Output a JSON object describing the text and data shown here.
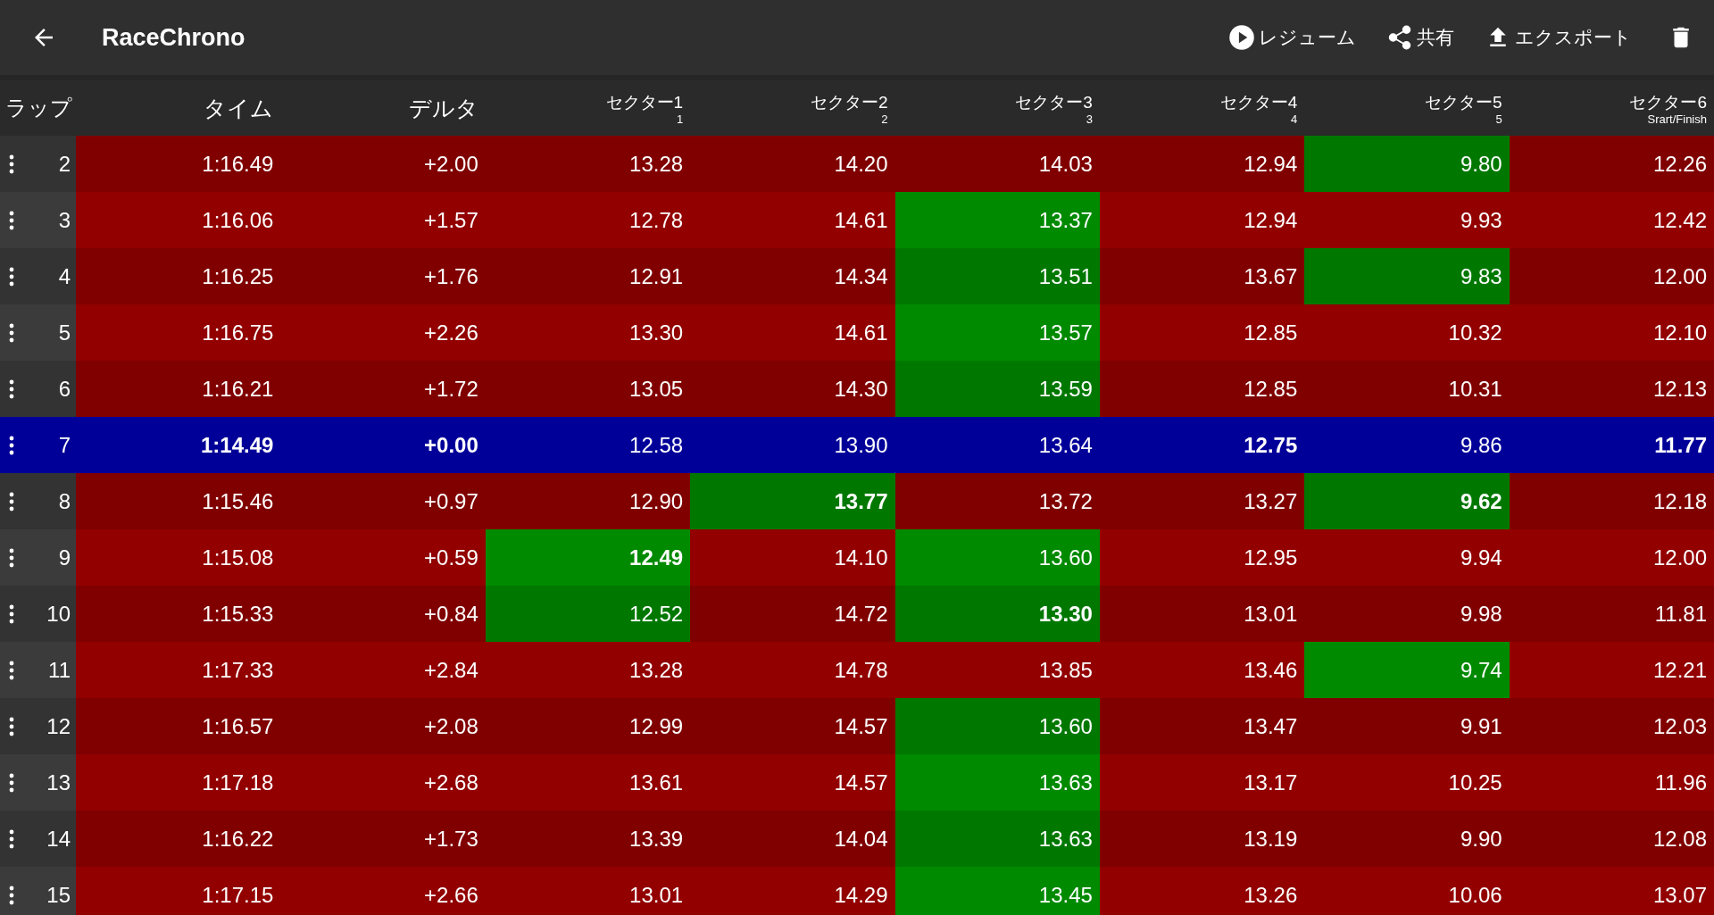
{
  "app_bar": {
    "title": "RaceChrono",
    "actions": [
      {
        "kind": "play",
        "label": "レジューム"
      },
      {
        "kind": "share",
        "label": "共有"
      },
      {
        "kind": "upload",
        "label": "エクスポート"
      },
      {
        "kind": "trash"
      }
    ]
  },
  "table": {
    "columns": [
      {
        "label": "ラップ"
      },
      {
        "label": "タイム"
      },
      {
        "label": "デルタ"
      },
      {
        "label": "セクター1",
        "sub": "1"
      },
      {
        "label": "セクター2",
        "sub": "2"
      },
      {
        "label": "セクター3",
        "sub": "3"
      },
      {
        "label": "セクター4",
        "sub": "4"
      },
      {
        "label": "セクター5",
        "sub": "5"
      },
      {
        "label": "セクター6",
        "sub": "Srart/Finish"
      }
    ],
    "rows": [
      {
        "selected": false,
        "cells": [
          {
            "kind": "lap",
            "text": "2"
          },
          {
            "kind": "value",
            "text": "1:16.49",
            "bold": false,
            "fast": false
          },
          {
            "kind": "value",
            "text": "+2.00",
            "bold": false,
            "fast": false
          },
          {
            "kind": "value",
            "text": "13.28",
            "bold": false,
            "fast": false
          },
          {
            "kind": "value",
            "text": "14.20",
            "bold": false,
            "fast": false
          },
          {
            "kind": "value",
            "text": "14.03",
            "bold": false,
            "fast": false
          },
          {
            "kind": "value",
            "text": "12.94",
            "bold": false,
            "fast": false
          },
          {
            "kind": "value",
            "text": "9.80",
            "bold": false,
            "fast": true
          },
          {
            "kind": "value",
            "text": "12.26",
            "bold": false,
            "fast": false
          }
        ]
      },
      {
        "selected": false,
        "cells": [
          {
            "kind": "lap",
            "text": "3"
          },
          {
            "kind": "value",
            "text": "1:16.06",
            "bold": false,
            "fast": false
          },
          {
            "kind": "value",
            "text": "+1.57",
            "bold": false,
            "fast": false
          },
          {
            "kind": "value",
            "text": "12.78",
            "bold": false,
            "fast": false
          },
          {
            "kind": "value",
            "text": "14.61",
            "bold": false,
            "fast": false
          },
          {
            "kind": "value",
            "text": "13.37",
            "bold": false,
            "fast": true
          },
          {
            "kind": "value",
            "text": "12.94",
            "bold": false,
            "fast": false
          },
          {
            "kind": "value",
            "text": "9.93",
            "bold": false,
            "fast": false
          },
          {
            "kind": "value",
            "text": "12.42",
            "bold": false,
            "fast": false
          }
        ]
      },
      {
        "selected": false,
        "cells": [
          {
            "kind": "lap",
            "text": "4"
          },
          {
            "kind": "value",
            "text": "1:16.25",
            "bold": false,
            "fast": false
          },
          {
            "kind": "value",
            "text": "+1.76",
            "bold": false,
            "fast": false
          },
          {
            "kind": "value",
            "text": "12.91",
            "bold": false,
            "fast": false
          },
          {
            "kind": "value",
            "text": "14.34",
            "bold": false,
            "fast": false
          },
          {
            "kind": "value",
            "text": "13.51",
            "bold": false,
            "fast": true
          },
          {
            "kind": "value",
            "text": "13.67",
            "bold": false,
            "fast": false
          },
          {
            "kind": "value",
            "text": "9.83",
            "bold": false,
            "fast": true
          },
          {
            "kind": "value",
            "text": "12.00",
            "bold": false,
            "fast": false
          }
        ]
      },
      {
        "selected": false,
        "cells": [
          {
            "kind": "lap",
            "text": "5"
          },
          {
            "kind": "value",
            "text": "1:16.75",
            "bold": false,
            "fast": false
          },
          {
            "kind": "value",
            "text": "+2.26",
            "bold": false,
            "fast": false
          },
          {
            "kind": "value",
            "text": "13.30",
            "bold": false,
            "fast": false
          },
          {
            "kind": "value",
            "text": "14.61",
            "bold": false,
            "fast": false
          },
          {
            "kind": "value",
            "text": "13.57",
            "bold": false,
            "fast": true
          },
          {
            "kind": "value",
            "text": "12.85",
            "bold": false,
            "fast": false
          },
          {
            "kind": "value",
            "text": "10.32",
            "bold": false,
            "fast": false
          },
          {
            "kind": "value",
            "text": "12.10",
            "bold": false,
            "fast": false
          }
        ]
      },
      {
        "selected": false,
        "cells": [
          {
            "kind": "lap",
            "text": "6"
          },
          {
            "kind": "value",
            "text": "1:16.21",
            "bold": false,
            "fast": false
          },
          {
            "kind": "value",
            "text": "+1.72",
            "bold": false,
            "fast": false
          },
          {
            "kind": "value",
            "text": "13.05",
            "bold": false,
            "fast": false
          },
          {
            "kind": "value",
            "text": "14.30",
            "bold": false,
            "fast": false
          },
          {
            "kind": "value",
            "text": "13.59",
            "bold": false,
            "fast": true
          },
          {
            "kind": "value",
            "text": "12.85",
            "bold": false,
            "fast": false
          },
          {
            "kind": "value",
            "text": "10.31",
            "bold": false,
            "fast": false
          },
          {
            "kind": "value",
            "text": "12.13",
            "bold": false,
            "fast": false
          }
        ]
      },
      {
        "selected": true,
        "cells": [
          {
            "kind": "lap",
            "text": "7"
          },
          {
            "kind": "value",
            "text": "1:14.49",
            "bold": true,
            "fast": false
          },
          {
            "kind": "value",
            "text": "+0.00",
            "bold": true,
            "fast": false
          },
          {
            "kind": "value",
            "text": "12.58",
            "bold": false,
            "fast": false
          },
          {
            "kind": "value",
            "text": "13.90",
            "bold": false,
            "fast": false
          },
          {
            "kind": "value",
            "text": "13.64",
            "bold": false,
            "fast": false
          },
          {
            "kind": "value",
            "text": "12.75",
            "bold": true,
            "fast": false
          },
          {
            "kind": "value",
            "text": "9.86",
            "bold": false,
            "fast": false
          },
          {
            "kind": "value",
            "text": "11.77",
            "bold": true,
            "fast": false
          }
        ]
      },
      {
        "selected": false,
        "cells": [
          {
            "kind": "lap",
            "text": "8"
          },
          {
            "kind": "value",
            "text": "1:15.46",
            "bold": false,
            "fast": false
          },
          {
            "kind": "value",
            "text": "+0.97",
            "bold": false,
            "fast": false
          },
          {
            "kind": "value",
            "text": "12.90",
            "bold": false,
            "fast": false
          },
          {
            "kind": "value",
            "text": "13.77",
            "bold": true,
            "fast": true
          },
          {
            "kind": "value",
            "text": "13.72",
            "bold": false,
            "fast": false
          },
          {
            "kind": "value",
            "text": "13.27",
            "bold": false,
            "fast": false
          },
          {
            "kind": "value",
            "text": "9.62",
            "bold": true,
            "fast": true
          },
          {
            "kind": "value",
            "text": "12.18",
            "bold": false,
            "fast": false
          }
        ]
      },
      {
        "selected": false,
        "cells": [
          {
            "kind": "lap",
            "text": "9"
          },
          {
            "kind": "value",
            "text": "1:15.08",
            "bold": false,
            "fast": false
          },
          {
            "kind": "value",
            "text": "+0.59",
            "bold": false,
            "fast": false
          },
          {
            "kind": "value",
            "text": "12.49",
            "bold": true,
            "fast": true
          },
          {
            "kind": "value",
            "text": "14.10",
            "bold": false,
            "fast": false
          },
          {
            "kind": "value",
            "text": "13.60",
            "bold": false,
            "fast": true
          },
          {
            "kind": "value",
            "text": "12.95",
            "bold": false,
            "fast": false
          },
          {
            "kind": "value",
            "text": "9.94",
            "bold": false,
            "fast": false
          },
          {
            "kind": "value",
            "text": "12.00",
            "bold": false,
            "fast": false
          }
        ]
      },
      {
        "selected": false,
        "cells": [
          {
            "kind": "lap",
            "text": "10"
          },
          {
            "kind": "value",
            "text": "1:15.33",
            "bold": false,
            "fast": false
          },
          {
            "kind": "value",
            "text": "+0.84",
            "bold": false,
            "fast": false
          },
          {
            "kind": "value",
            "text": "12.52",
            "bold": false,
            "fast": true
          },
          {
            "kind": "value",
            "text": "14.72",
            "bold": false,
            "fast": false
          },
          {
            "kind": "value",
            "text": "13.30",
            "bold": true,
            "fast": true
          },
          {
            "kind": "value",
            "text": "13.01",
            "bold": false,
            "fast": false
          },
          {
            "kind": "value",
            "text": "9.98",
            "bold": false,
            "fast": false
          },
          {
            "kind": "value",
            "text": "11.81",
            "bold": false,
            "fast": false
          }
        ]
      },
      {
        "selected": false,
        "cells": [
          {
            "kind": "lap",
            "text": "11"
          },
          {
            "kind": "value",
            "text": "1:17.33",
            "bold": false,
            "fast": false
          },
          {
            "kind": "value",
            "text": "+2.84",
            "bold": false,
            "fast": false
          },
          {
            "kind": "value",
            "text": "13.28",
            "bold": false,
            "fast": false
          },
          {
            "kind": "value",
            "text": "14.78",
            "bold": false,
            "fast": false
          },
          {
            "kind": "value",
            "text": "13.85",
            "bold": false,
            "fast": false
          },
          {
            "kind": "value",
            "text": "13.46",
            "bold": false,
            "fast": false
          },
          {
            "kind": "value",
            "text": "9.74",
            "bold": false,
            "fast": true
          },
          {
            "kind": "value",
            "text": "12.21",
            "bold": false,
            "fast": false
          }
        ]
      },
      {
        "selected": false,
        "cells": [
          {
            "kind": "lap",
            "text": "12"
          },
          {
            "kind": "value",
            "text": "1:16.57",
            "bold": false,
            "fast": false
          },
          {
            "kind": "value",
            "text": "+2.08",
            "bold": false,
            "fast": false
          },
          {
            "kind": "value",
            "text": "12.99",
            "bold": false,
            "fast": false
          },
          {
            "kind": "value",
            "text": "14.57",
            "bold": false,
            "fast": false
          },
          {
            "kind": "value",
            "text": "13.60",
            "bold": false,
            "fast": true
          },
          {
            "kind": "value",
            "text": "13.47",
            "bold": false,
            "fast": false
          },
          {
            "kind": "value",
            "text": "9.91",
            "bold": false,
            "fast": false
          },
          {
            "kind": "value",
            "text": "12.03",
            "bold": false,
            "fast": false
          }
        ]
      },
      {
        "selected": false,
        "cells": [
          {
            "kind": "lap",
            "text": "13"
          },
          {
            "kind": "value",
            "text": "1:17.18",
            "bold": false,
            "fast": false
          },
          {
            "kind": "value",
            "text": "+2.68",
            "bold": false,
            "fast": false
          },
          {
            "kind": "value",
            "text": "13.61",
            "bold": false,
            "fast": false
          },
          {
            "kind": "value",
            "text": "14.57",
            "bold": false,
            "fast": false
          },
          {
            "kind": "value",
            "text": "13.63",
            "bold": false,
            "fast": true
          },
          {
            "kind": "value",
            "text": "13.17",
            "bold": false,
            "fast": false
          },
          {
            "kind": "value",
            "text": "10.25",
            "bold": false,
            "fast": false
          },
          {
            "kind": "value",
            "text": "11.96",
            "bold": false,
            "fast": false
          }
        ]
      },
      {
        "selected": false,
        "cells": [
          {
            "kind": "lap",
            "text": "14"
          },
          {
            "kind": "value",
            "text": "1:16.22",
            "bold": false,
            "fast": false
          },
          {
            "kind": "value",
            "text": "+1.73",
            "bold": false,
            "fast": false
          },
          {
            "kind": "value",
            "text": "13.39",
            "bold": false,
            "fast": false
          },
          {
            "kind": "value",
            "text": "14.04",
            "bold": false,
            "fast": false
          },
          {
            "kind": "value",
            "text": "13.63",
            "bold": false,
            "fast": true
          },
          {
            "kind": "value",
            "text": "13.19",
            "bold": false,
            "fast": false
          },
          {
            "kind": "value",
            "text": "9.90",
            "bold": false,
            "fast": false
          },
          {
            "kind": "value",
            "text": "12.08",
            "bold": false,
            "fast": false
          }
        ]
      },
      {
        "selected": false,
        "cells": [
          {
            "kind": "lap",
            "text": "15"
          },
          {
            "kind": "value",
            "text": "1:17.15",
            "bold": false,
            "fast": false
          },
          {
            "kind": "value",
            "text": "+2.66",
            "bold": false,
            "fast": false
          },
          {
            "kind": "value",
            "text": "13.01",
            "bold": false,
            "fast": false
          },
          {
            "kind": "value",
            "text": "14.29",
            "bold": false,
            "fast": false
          },
          {
            "kind": "value",
            "text": "13.45",
            "bold": false,
            "fast": true
          },
          {
            "kind": "value",
            "text": "13.26",
            "bold": false,
            "fast": false
          },
          {
            "kind": "value",
            "text": "10.06",
            "bold": false,
            "fast": false
          },
          {
            "kind": "value",
            "text": "13.07",
            "bold": false,
            "fast": false
          }
        ]
      }
    ]
  }
}
